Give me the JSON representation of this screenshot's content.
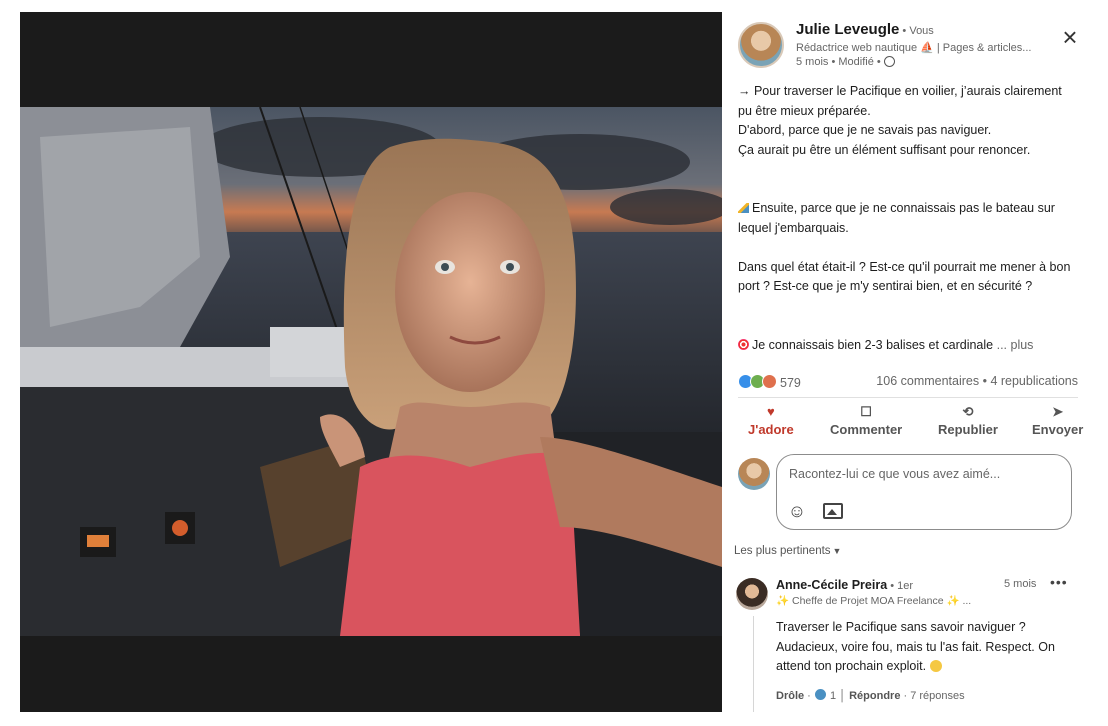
{
  "post": {
    "author_name": "Julie Leveugle",
    "author_badge": " • Vous",
    "headline": "Rédactrice web nautique ⛵ | Pages & articles...",
    "meta_text": "5 mois • Modifié • ",
    "paragraphs": [
      "→ Pour traverser le Pacifique en voilier, j’aurais clairement pu être mieux préparée.",
      "D'abord, parce que je ne savais pas naviguer.",
      "Ça aurait pu être un élément suffisant pour renoncer.",
      "Ensuite, parce que je ne connaissais pas le bateau sur lequel j'embarquais.",
      "Dans quel état était-il ? Est-ce qu'il pourrait me mener à bon port ? Est-ce que je m'y sentirai bien, et en sécurité ?",
      "Je connaissais bien 2-3 balises et cardinale"
    ],
    "more_label": "... plus",
    "reactions_count": "579",
    "comments_reposts": "106 commentaires • 4 republications"
  },
  "actions": {
    "like": "J'adore",
    "comment": "Commenter",
    "repost": "Republier",
    "send": "Envoyer"
  },
  "composer": {
    "placeholder": "Racontez-lui ce que vous avez aimé..."
  },
  "sort_label": "Les plus pertinents",
  "comment": {
    "author": "Anne-Cécile Preira",
    "degree": " • 1er",
    "time": "5 mois",
    "headline": "✨ Cheffe de Projet MOA Freelance ✨ ...",
    "text": "Traverser le Pacifique sans savoir naviguer ? Audacieux, voire fou, mais tu l'as fait. Respect. On attend ton prochain exploit.",
    "like_label": "Drôle",
    "like_count": "1",
    "reply_label": "Répondre",
    "replies": "7 réponses"
  },
  "colors": {
    "accent_love": "#c0392b",
    "text_secondary": "#666666"
  },
  "icons": [
    "close-icon",
    "globe-icon",
    "heart-icon",
    "comment-icon",
    "repost-icon",
    "send-icon",
    "emoji-icon",
    "image-icon",
    "more-icon"
  ]
}
